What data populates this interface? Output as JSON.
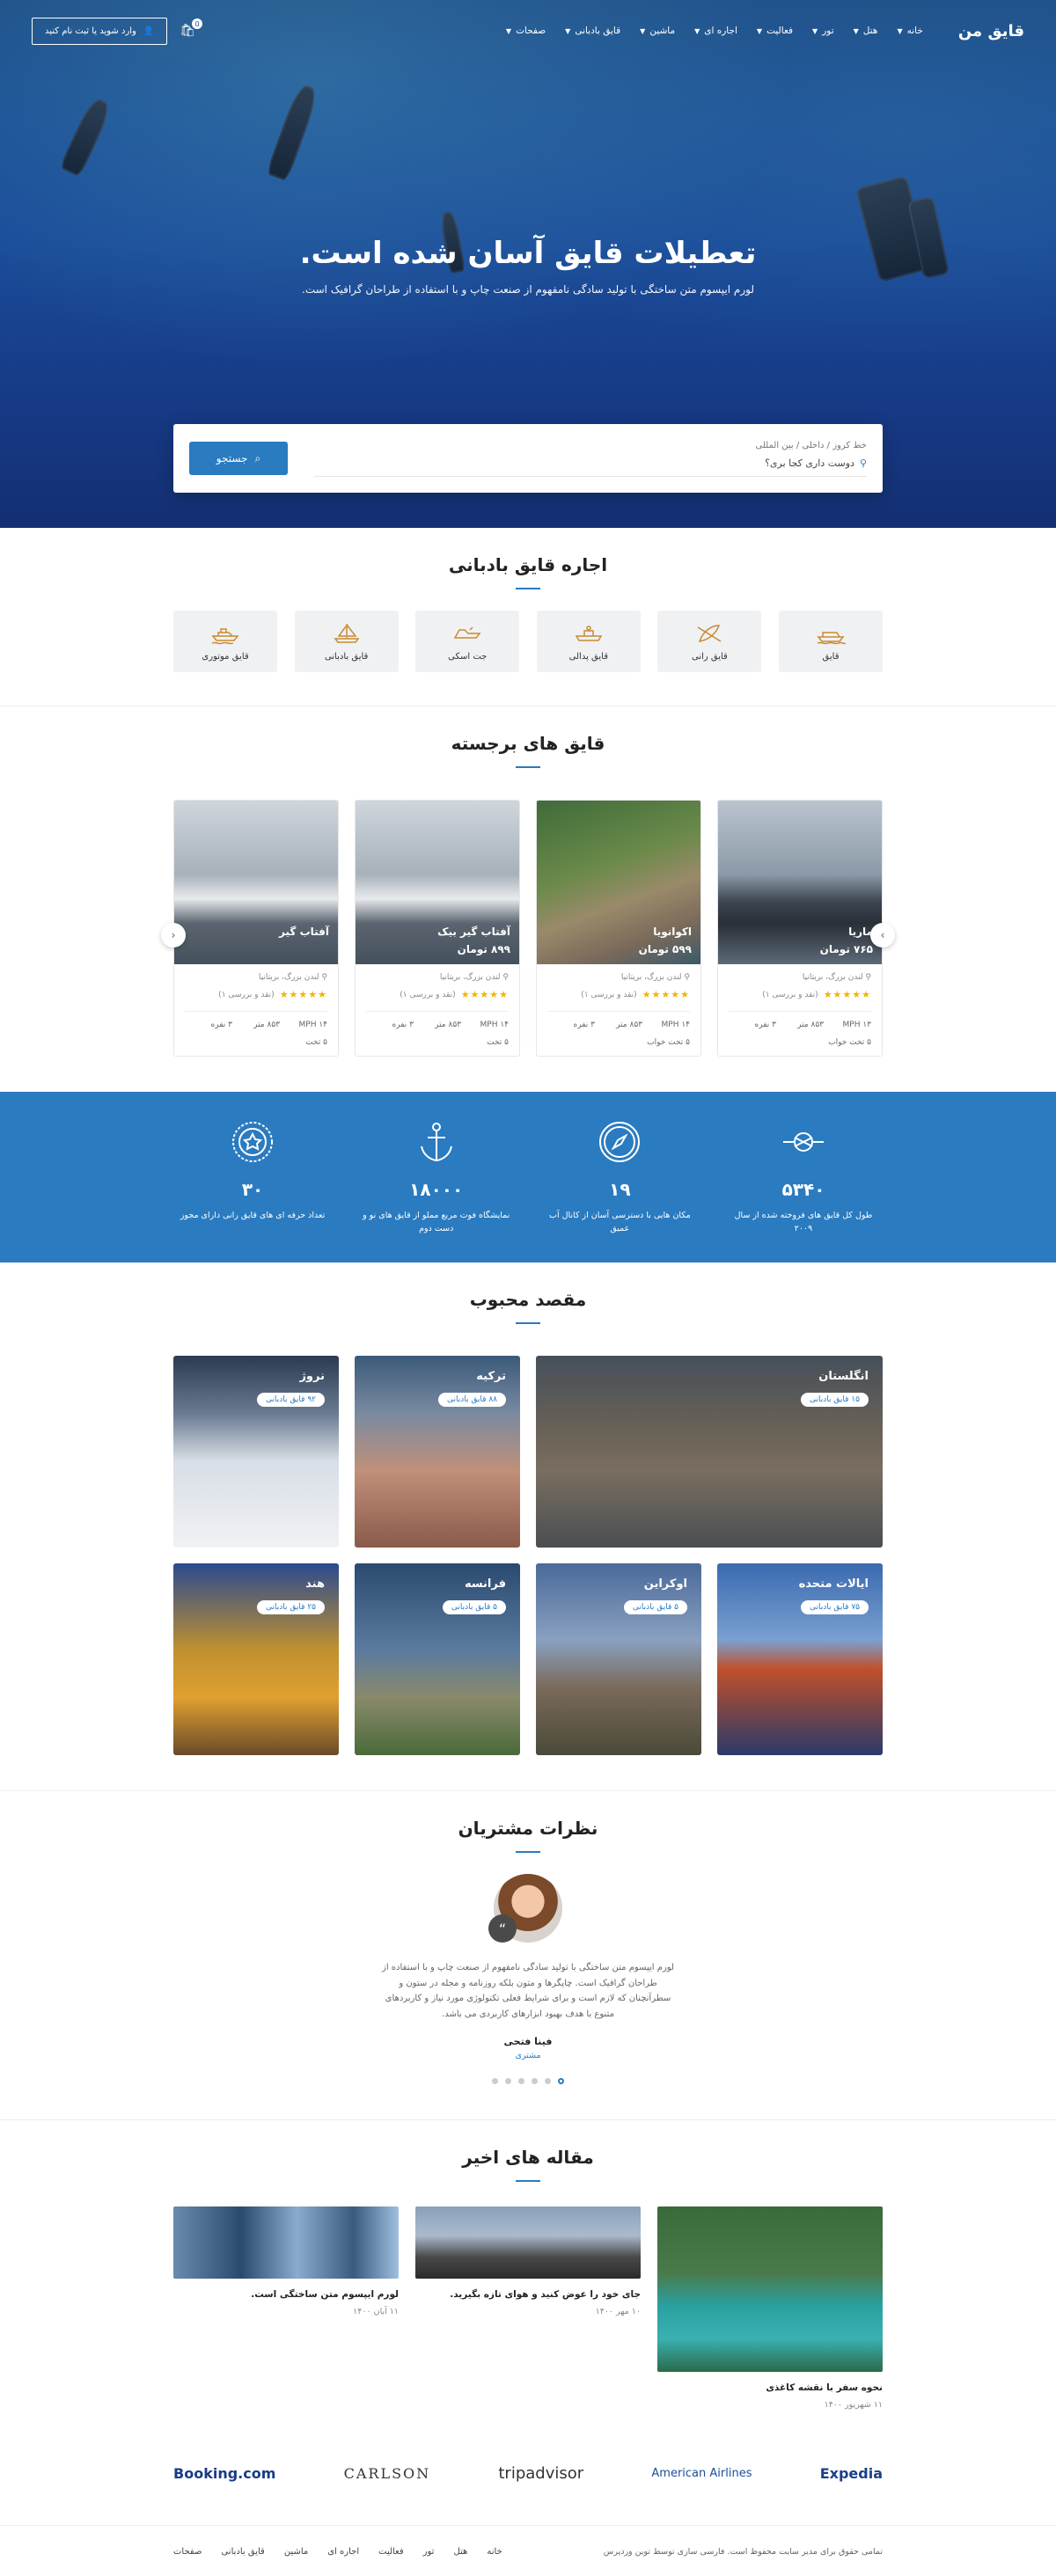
{
  "header": {
    "logo": "قایق من",
    "nav": [
      "خانه",
      "هتل",
      "تور",
      "فعالیت",
      "اجاره ای",
      "ماشین",
      "قایق بادبانی",
      "صفحات"
    ],
    "cart_count": "0",
    "login_label": "وارد شوید یا ثبت نام کنید"
  },
  "hero": {
    "title": "تعطیلات قایق آسان شده است.",
    "subtitle": "لورم ایپسوم متن ساختگی با تولید سادگی نامفهوم از صنعت چاپ و با استفاده از طراحان گرافیک است.",
    "search_label": "خط کروز / داخلی / بین المللی",
    "search_placeholder": "دوست داری کجا بری؟",
    "search_button": "جستجو"
  },
  "categories": {
    "title": "اجاره قایق بادبانی",
    "items": [
      {
        "label": "قایق",
        "icon": "boat-icon"
      },
      {
        "label": "قایق رانی",
        "icon": "kayak-icon"
      },
      {
        "label": "قایق پدالی",
        "icon": "pedal-boat-icon"
      },
      {
        "label": "جت اسکی",
        "icon": "jet-ski-icon"
      },
      {
        "label": "قایق بادبانی",
        "icon": "sailboat-icon"
      },
      {
        "label": "قایق موتوری",
        "icon": "motorboat-icon"
      }
    ]
  },
  "featured": {
    "title": "قایق های برجسته",
    "cards": [
      {
        "name": "ماریا",
        "price": "۷۶۵ تومان",
        "location": "لندن بزرگ، بریتانیا",
        "review": "(نقد و بررسی ۱)",
        "speed": "MPH ۱۳",
        "size": "۸۵۳ متر",
        "people": "۳ نفره",
        "cabins": "۵ تخت خواب"
      },
      {
        "name": "اکوانویا",
        "price": "۵۹۹ تومان",
        "location": "لندن بزرگ، بریتانیا",
        "review": "(نقد و بررسی ۱)",
        "speed": "MPH ۱۴",
        "size": "۸۵۳ متر",
        "people": "۳ نفره",
        "cabins": "۵ تخت خواب"
      },
      {
        "name": "آفتاب گیر بیک",
        "price": "۸۹۹ تومان",
        "location": "لندن بزرگ، بریتانیا",
        "review": "(نقد و بررسی ۱)",
        "speed": "MPH ۱۴",
        "size": "۸۵۳ متر",
        "people": "۳ نفره",
        "cabins": "۵ تخت"
      },
      {
        "name": "آفتاب گیر",
        "price": "",
        "location": "لندن بزرگ، بریتانیا",
        "review": "(نقد و بررسی ۱)",
        "speed": "MPH ۱۴",
        "size": "۸۵۳ متر",
        "people": "۳ نفره",
        "cabins": "۵ تخت"
      }
    ]
  },
  "stats": [
    {
      "num": "۵۳۴۰",
      "label": "طول کل قایق های فروخته شده از سال ۲۰۰۹",
      "icon": "knot-icon"
    },
    {
      "num": "۱۹",
      "label": "مکان هایی با دسترسی آسان از کانال آب عمیق",
      "icon": "compass-icon"
    },
    {
      "num": "۱۸۰۰۰",
      "label": "نمایشگاه فوت مربع مملو از قایق های نو و دست دوم",
      "icon": "anchor-icon"
    },
    {
      "num": "۳۰",
      "label": "تعداد حرفه ای های قایق رانی دارای مجوز",
      "icon": "badge-icon"
    }
  ],
  "destinations": {
    "title": "مقصد محبوب",
    "items": [
      {
        "name": "انگلستان",
        "count": "۱۵ قایق بادبانی"
      },
      {
        "name": "ترکیه",
        "count": "۸۸ قایق بادبانی"
      },
      {
        "name": "نروژ",
        "count": "۹۲ قایق بادبانی"
      },
      {
        "name": "ایالات متحده",
        "count": "۷۵ قایق بادبانی"
      },
      {
        "name": "اوکراین",
        "count": "۵ قایق بادبانی"
      },
      {
        "name": "فرانسه",
        "count": "۵ قایق بادبانی"
      },
      {
        "name": "هند",
        "count": "۲۵ قایق بادبانی"
      }
    ]
  },
  "testimonials": {
    "title": "نظرات مشتریان",
    "text": "لورم ایپسوم متن ساختگی با تولید سادگی نامفهوم از صنعت چاپ و با استفاده از طراحان گرافیک است. چاپگرها و متون بلکه روزنامه و مجله در ستون و سطرآنچنان که لازم است و برای شرایط فعلی تکنولوژی مورد نیاز و کاربردهای متنوع با هدف بهبود ابزارهای کاربردی می باشد.",
    "name": "فینا فتحی",
    "role": "مشتری"
  },
  "articles": {
    "title": "مقاله های اخیر",
    "items": [
      {
        "title": "نحوه سفر با نقشه کاغذی",
        "date": "۱۱ شهریور ۱۴۰۰"
      },
      {
        "title": "جای خود را عوض کنید و هوای تازه بگیرید.",
        "date": "۱۰ مهر ۱۴۰۰"
      },
      {
        "title": "لورم ایپسوم متن ساختگی است.",
        "date": "۱۱ آبان ۱۴۰۰"
      }
    ]
  },
  "brands": [
    "Expedia",
    "American Airlines",
    "tripadvisor",
    "CARLSON",
    "Booking.com"
  ],
  "footer": {
    "copyright": "تمامی حقوق برای مدیر سایت محفوظ است. فارسی سازی توسط توین وردپرس",
    "links": [
      "خانه",
      "هتل",
      "تور",
      "فعالیت",
      "اجاره ای",
      "ماشین",
      "قایق بادبانی",
      "صفحات"
    ]
  },
  "colors": {
    "accent": "#2a7bc0",
    "star": "#f4b400"
  }
}
